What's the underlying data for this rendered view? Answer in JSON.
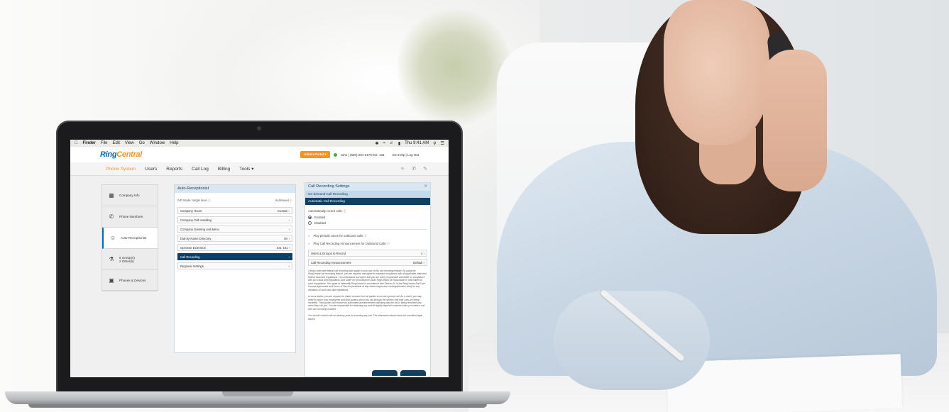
{
  "menubar": {
    "apple": "",
    "app": "Finder",
    "items": [
      "File",
      "Edit",
      "View",
      "Go",
      "Window",
      "Help"
    ],
    "clock": "Thu 9:41 AM"
  },
  "header": {
    "logo_ring": "Ring",
    "logo_central": "Central",
    "admin_portal": "Admin Portal",
    "user": "John | (650) 294-0170 Ext. 101",
    "help": "Get Help | Log Out"
  },
  "nav": {
    "tabs": [
      "Phone System",
      "Users",
      "Reports",
      "Call Log",
      "Billing",
      "Tools ▾"
    ],
    "active": "Phone System"
  },
  "sidebar": {
    "items": [
      {
        "label": "Company Info",
        "icon": "building-icon"
      },
      {
        "label": "Phone Numbers",
        "icon": "phone-icon"
      },
      {
        "label": "Auto-Receptionist",
        "icon": "receptionist-icon"
      },
      {
        "label": "5 Group(s)\n2 Other(s)",
        "icon": "group-icon"
      },
      {
        "label": "Phones & Devices",
        "icon": "device-icon"
      }
    ]
  },
  "auto_receptionist": {
    "title": "Auto-Receptionist",
    "ivr_left": "IVR Mode: single level ⓘ",
    "ivr_right": "multi-level ⓘ",
    "rows": [
      {
        "label": "Company Hours",
        "value": "Custom"
      },
      {
        "label": "Company Call Handling",
        "value": ""
      },
      {
        "label": "Company Greeting and Menu",
        "value": ""
      },
      {
        "label": "Dial-by-Name Directory",
        "value": "On"
      },
      {
        "label": "Operator Extension",
        "value": "Ext. 101"
      },
      {
        "label": "Call Recording",
        "value": ""
      },
      {
        "label": "Regional Settings",
        "value": ""
      }
    ]
  },
  "call_recording": {
    "title": "Call Recording Settings",
    "on_demand": "On-demand Call Recording",
    "automatic": "Automatic Call Recording",
    "auto_label": "Automatically record calls: ⓘ",
    "enabled": "Enabled",
    "disabled": "Disabled",
    "check1": "Play periodic tones for outbound calls ⓘ",
    "check2": "Play Call Recording Announcement for Outbound Calls ⓘ",
    "users_groups": "Users & Groups to Record",
    "users_groups_val": "4",
    "announcement": "Call Recording Announcement",
    "announcement_val": "Default",
    "legal1": "Certain state and federal call recording laws apply to your use of this call recording feature. By using the RingCentral call recording feature, you are required and agree to maintain compliance with all applicable state and federal laws and regulations. You understand and agree that you are solely responsible and liable for compliance with such laws and regulations, and under no circumstances shall RingCentral be responsible or held liable for such compliance. You agree to indemnify RingCentral in accordance with Section 25 of the RingCentral End User License Agreement and Terms of Service (available at http://www.ringcentral.com/legal/eulatos.html) for any violations of such laws and regulations.",
    "legal2": "In some states, you are required to obtain consent from all parties to record a phone call. As a result, you may need to inform your employees and third-parties whom you call through the service that their calls are being recorded. Third parties will receive an automated announcement indicating that the call is being recorded only when they call you. You are responsible for obtaining any and all legally-required consents when you make a call with call recording enabled.",
    "legal3": "You should consult with an attorney prior to recording any call. The information above does not constitute legal advice."
  }
}
